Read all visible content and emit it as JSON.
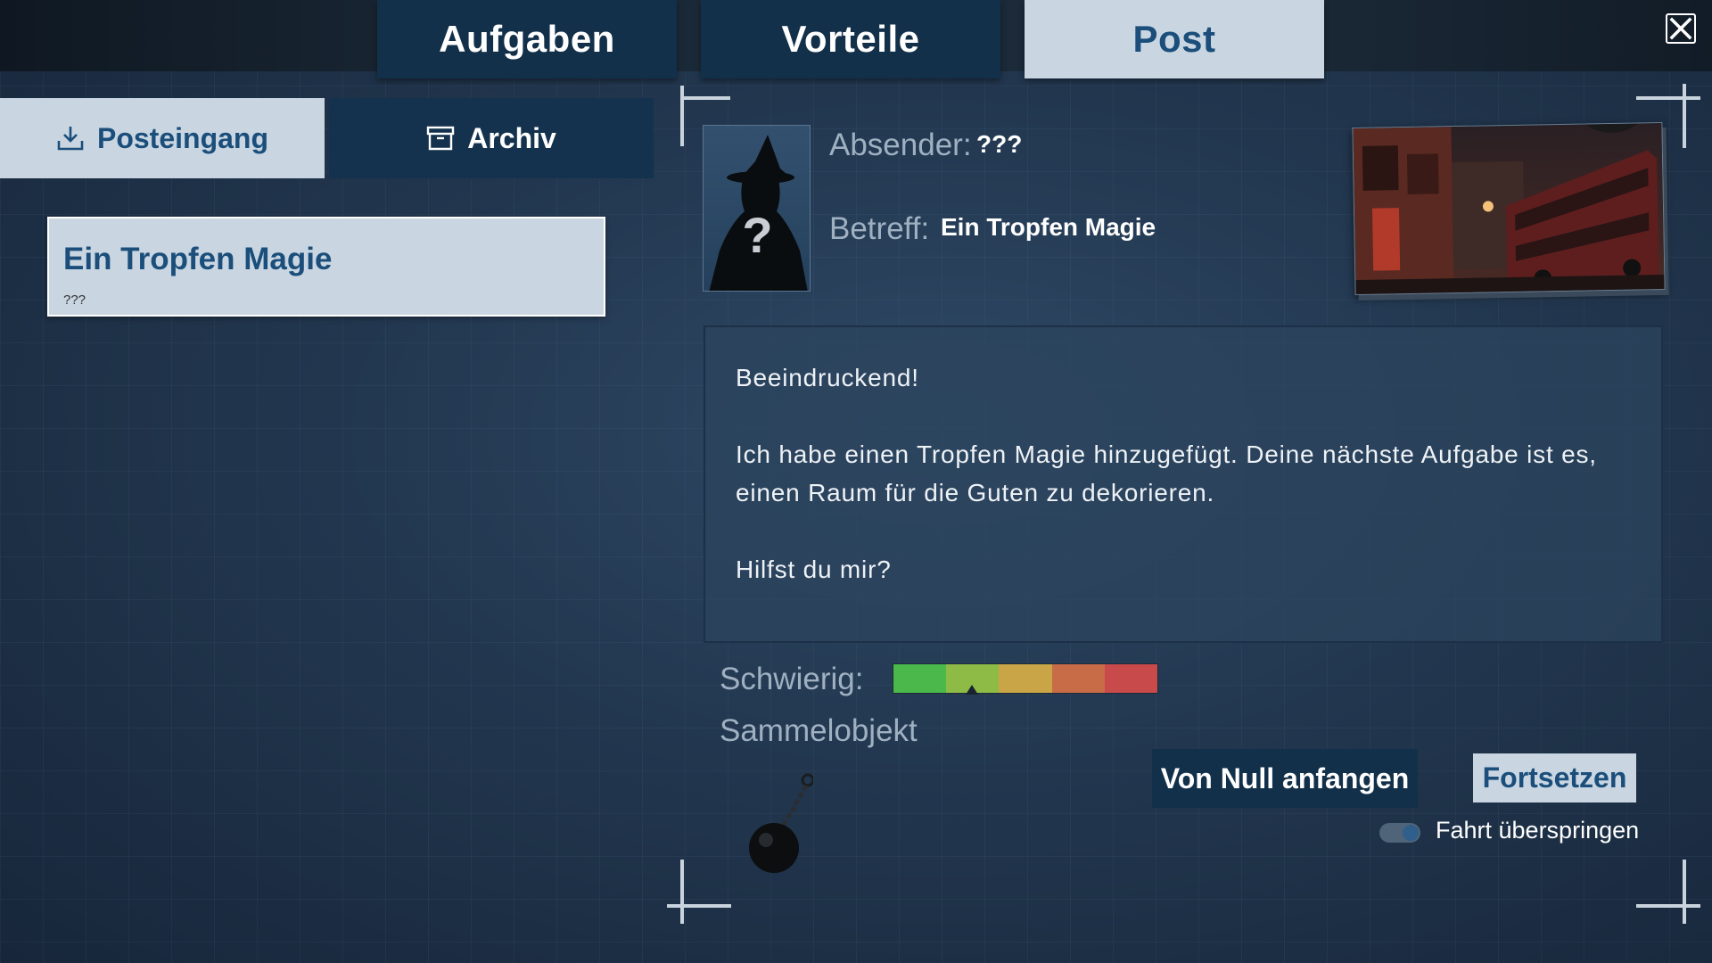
{
  "main_tabs": [
    {
      "label": "Aufgaben",
      "active": false
    },
    {
      "label": "Vorteile",
      "active": false
    },
    {
      "label": "Post",
      "active": true
    }
  ],
  "mail_tabs": {
    "inbox_label": "Posteingang",
    "archive_label": "Archiv",
    "active": "inbox"
  },
  "mail_list": [
    {
      "subject": "Ein Tropfen Magie",
      "sender": "???"
    }
  ],
  "detail": {
    "sender_label": "Absender:",
    "sender_value": "???",
    "subject_label": "Betreff:",
    "subject_value": "Ein Tropfen Magie",
    "avatar_glyph": "?",
    "body": [
      "Beeindruckend!",
      "Ich habe einen Tropfen Magie hinzugefügt. Deine nächste Aufgabe ist es, einen Raum für die Guten zu dekorieren.",
      "Hilfst du mir?"
    ],
    "difficulty_label": "Schwierig:",
    "difficulty_level": 0.3,
    "difficulty_colors": [
      "#4ab84a",
      "#8dbb45",
      "#c9a547",
      "#c86b47",
      "#c84a4a"
    ],
    "collectible_label": "Sammelobjekt",
    "collectible_icon": "wrecking-ball-icon"
  },
  "actions": {
    "restart_label": "Von Null anfangen",
    "continue_label": "Fortsetzen",
    "skip_ride_label": "Fahrt überspringen",
    "skip_ride_enabled": true
  },
  "colors": {
    "accent_light": "#c9d6e2",
    "accent_text": "#1b4e7a",
    "tab_dark": "#13304a"
  }
}
